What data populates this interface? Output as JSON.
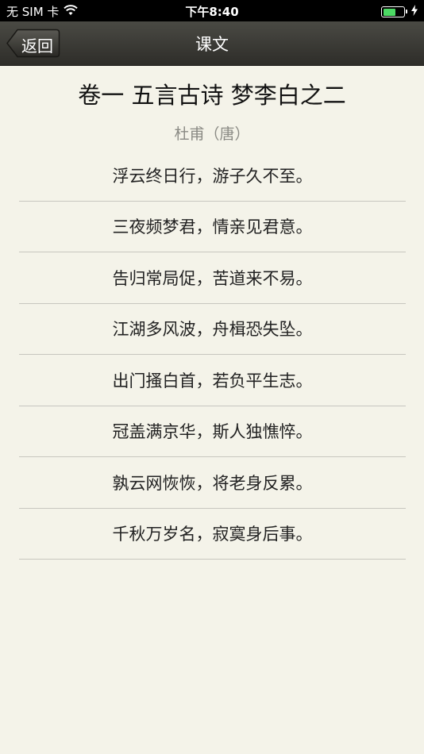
{
  "status_bar": {
    "carrier": "无 SIM 卡",
    "time": "下午8:40",
    "battery_level": 0.6,
    "battery_color": "#4cd964"
  },
  "nav": {
    "back_label": "返回",
    "title": "课文"
  },
  "poem": {
    "title": "卷一 五言古诗 梦李白之二",
    "author": "杜甫（唐）",
    "lines": [
      "浮云终日行，游子久不至。",
      "三夜频梦君，情亲见君意。",
      "告归常局促，苦道来不易。",
      "江湖多风波，舟楫恐失坠。",
      "出门搔白首，若负平生志。",
      "冠盖满京华，斯人独憔悴。",
      "孰云网恢恢，将老身反累。",
      "千秋万岁名，寂寞身后事。"
    ]
  },
  "icons": {
    "wifi": "wifi-icon",
    "battery": "battery-icon",
    "charging": "charging-bolt-icon",
    "back": "back-chevron-icon"
  }
}
